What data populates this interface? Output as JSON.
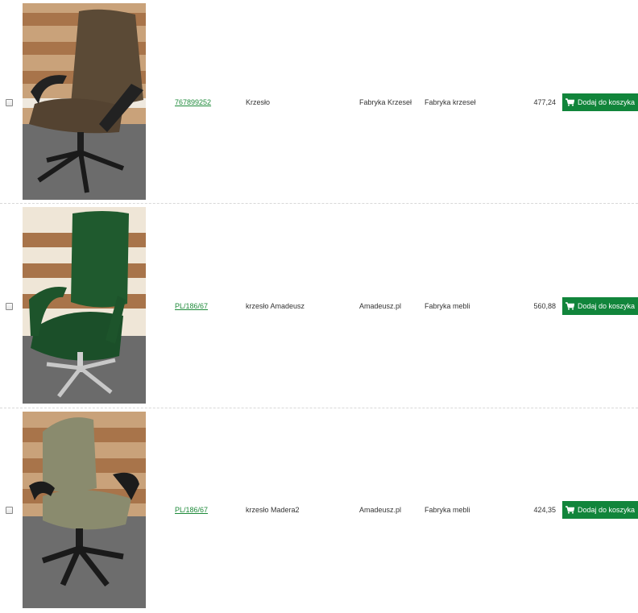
{
  "products": [
    {
      "code": "767899252",
      "name": "Krzesło",
      "manufacturer": "Fabryka Krzeseł",
      "category": "Fabryka krzeseł",
      "price": "477,24",
      "button_label": "Dodaj do koszyka",
      "chair_color": "#5b4a36"
    },
    {
      "code": "PL/186/67",
      "name": "krzesło Amadeusz",
      "manufacturer": "Amadeusz.pl",
      "category": "Fabryka mebli",
      "price": "560,88",
      "button_label": "Dodaj do koszyka",
      "chair_color": "#1f5a2e"
    },
    {
      "code": "PL/186/67",
      "name": "krzesło Madera2",
      "manufacturer": "Amadeusz.pl",
      "category": "Fabryka mebli",
      "price": "424,35",
      "button_label": "Dodaj do koszyka",
      "chair_color": "#8a8b6e"
    }
  ],
  "colors": {
    "accent": "#11853b",
    "link": "#1e8a3a"
  },
  "icons": {
    "cart": "cart-icon"
  }
}
